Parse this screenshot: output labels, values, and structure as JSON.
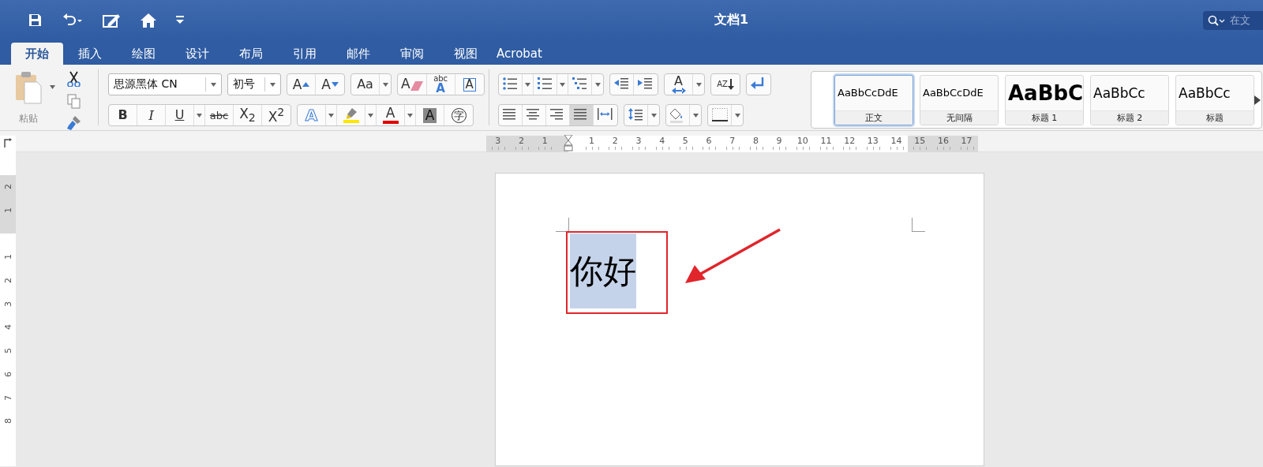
{
  "window": {
    "title": "文档1"
  },
  "quick_access": [
    {
      "kind": "save"
    },
    {
      "kind": "undo"
    },
    {
      "kind": "edit"
    },
    {
      "kind": "home"
    },
    {
      "kind": "customize"
    }
  ],
  "search": {
    "placeholder": "在文"
  },
  "tabs": [
    {
      "label": "开始",
      "selected": true
    },
    {
      "label": "插入",
      "selected": false
    },
    {
      "label": "绘图",
      "selected": false
    },
    {
      "label": "设计",
      "selected": false
    },
    {
      "label": "布局",
      "selected": false
    },
    {
      "label": "引用",
      "selected": false
    },
    {
      "label": "邮件",
      "selected": false
    },
    {
      "label": "审阅",
      "selected": false
    },
    {
      "label": "视图",
      "selected": false
    },
    {
      "label": "Acrobat",
      "selected": false
    }
  ],
  "clipboard": {
    "paste_label": "粘贴",
    "tools": [
      {
        "kind": "cut"
      },
      {
        "kind": "copy"
      },
      {
        "kind": "painter"
      }
    ]
  },
  "font": {
    "name": "思源黑体 CN",
    "size": "初号",
    "row1": [
      [
        {
          "kind": "grow",
          "glyph": "A"
        },
        {
          "kind": "shrink",
          "glyph": "A"
        }
      ],
      [
        {
          "kind": "case",
          "glyph": "Aa",
          "dropdown": true
        }
      ],
      [
        {
          "kind": "clear",
          "glyph": "A"
        },
        {
          "kind": "phonetic",
          "glyph": "abc",
          "sub_glyph": "A"
        },
        {
          "kind": "border",
          "glyph": "A"
        }
      ]
    ],
    "row2": [
      [
        {
          "kind": "bold",
          "glyph": "B"
        },
        {
          "kind": "italic",
          "glyph": "I"
        },
        {
          "kind": "underline",
          "glyph": "U",
          "dropdown": true
        },
        {
          "kind": "strike",
          "glyph": "abc"
        },
        {
          "kind": "subscript",
          "glyph": "X$_{2}$"
        },
        {
          "kind": "superscript",
          "glyph": "X$^{2}$"
        }
      ],
      [
        {
          "kind": "effects",
          "glyph": "A",
          "dropdown": true
        },
        {
          "kind": "highlight",
          "dropdown": true,
          "color": "#ffe600"
        },
        {
          "kind": "font_color",
          "glyph": "A",
          "dropdown": true,
          "color": "#e00000"
        },
        {
          "kind": "shading",
          "glyph": "A"
        },
        {
          "kind": "enclose",
          "glyph": "字"
        }
      ]
    ]
  },
  "paragraph": {
    "row1": [
      [
        {
          "kind": "bullets",
          "dropdown": true
        },
        {
          "kind": "numbering",
          "dropdown": true
        },
        {
          "kind": "multilevel",
          "dropdown": true
        }
      ],
      [
        {
          "kind": "outdent"
        },
        {
          "kind": "indent"
        }
      ],
      [
        {
          "kind": "direction",
          "glyph": "A",
          "dropdown": true
        }
      ],
      [
        {
          "kind": "sort",
          "glyph": "A",
          "sub_glyph": "Z"
        }
      ],
      [
        {
          "kind": "marks"
        }
      ]
    ],
    "alignment": [
      {
        "kind": "left",
        "selected": false
      },
      {
        "kind": "center",
        "selected": false
      },
      {
        "kind": "right",
        "selected": false
      },
      {
        "kind": "justify",
        "selected": true
      },
      {
        "kind": "distributed",
        "selected": false
      }
    ],
    "row2": [
      [
        {
          "kind": "spacing",
          "dropdown": true
        }
      ],
      [
        {
          "kind": "fill",
          "dropdown": true
        }
      ],
      [
        {
          "kind": "borders",
          "dropdown": true
        }
      ]
    ]
  },
  "styles": [
    {
      "preview": "AaBbCcDdE",
      "name": "正文",
      "kind": "normal",
      "selected": true
    },
    {
      "preview": "AaBbCcDdE",
      "name": "无间隔",
      "kind": "normal",
      "selected": false
    },
    {
      "preview": "AaBbC",
      "name": "标题 1",
      "kind": "heading1",
      "selected": false
    },
    {
      "preview": "AaBbCc",
      "name": "标题 2",
      "kind": "heading2",
      "selected": false
    },
    {
      "preview": "AaBbCc",
      "name": "标题",
      "kind": "title",
      "selected": false
    }
  ],
  "ruler": [
    {
      "text": "3",
      "margin": true
    },
    {
      "text": "2",
      "margin": true
    },
    {
      "text": "1",
      "margin": true
    },
    {
      "kind": "indent"
    },
    {
      "text": "1",
      "margin": false
    },
    {
      "text": "2",
      "margin": false
    },
    {
      "text": "3",
      "margin": false
    },
    {
      "text": "4",
      "margin": false
    },
    {
      "text": "5",
      "margin": false
    },
    {
      "text": "6",
      "margin": false
    },
    {
      "text": "7",
      "margin": false
    },
    {
      "text": "8",
      "margin": false
    },
    {
      "text": "9",
      "margin": false
    },
    {
      "text": "10",
      "margin": false
    },
    {
      "text": "11",
      "margin": false
    },
    {
      "text": "12",
      "margin": false
    },
    {
      "text": "13",
      "margin": false
    },
    {
      "text": "14",
      "margin": false
    },
    {
      "text": "15",
      "margin": true
    },
    {
      "text": "16",
      "margin": true
    },
    {
      "text": "17",
      "margin": true
    }
  ],
  "vertical_ruler": [
    {
      "text": "2",
      "margin": true
    },
    {
      "text": "1",
      "margin": true
    },
    {
      "kind": "boundary"
    },
    {
      "text": "1",
      "margin": false
    },
    {
      "text": "2",
      "margin": false
    },
    {
      "text": "3",
      "margin": false
    },
    {
      "text": "4",
      "margin": false
    },
    {
      "text": "5",
      "margin": false
    },
    {
      "text": "6",
      "margin": false
    },
    {
      "text": "7",
      "margin": false
    },
    {
      "text": "8",
      "margin": false
    }
  ],
  "document": {
    "text": "你好",
    "selected": true
  },
  "annotations": {
    "box": {
      "color": "#e0252b"
    },
    "arrow": {
      "color": "#e0252b"
    }
  }
}
